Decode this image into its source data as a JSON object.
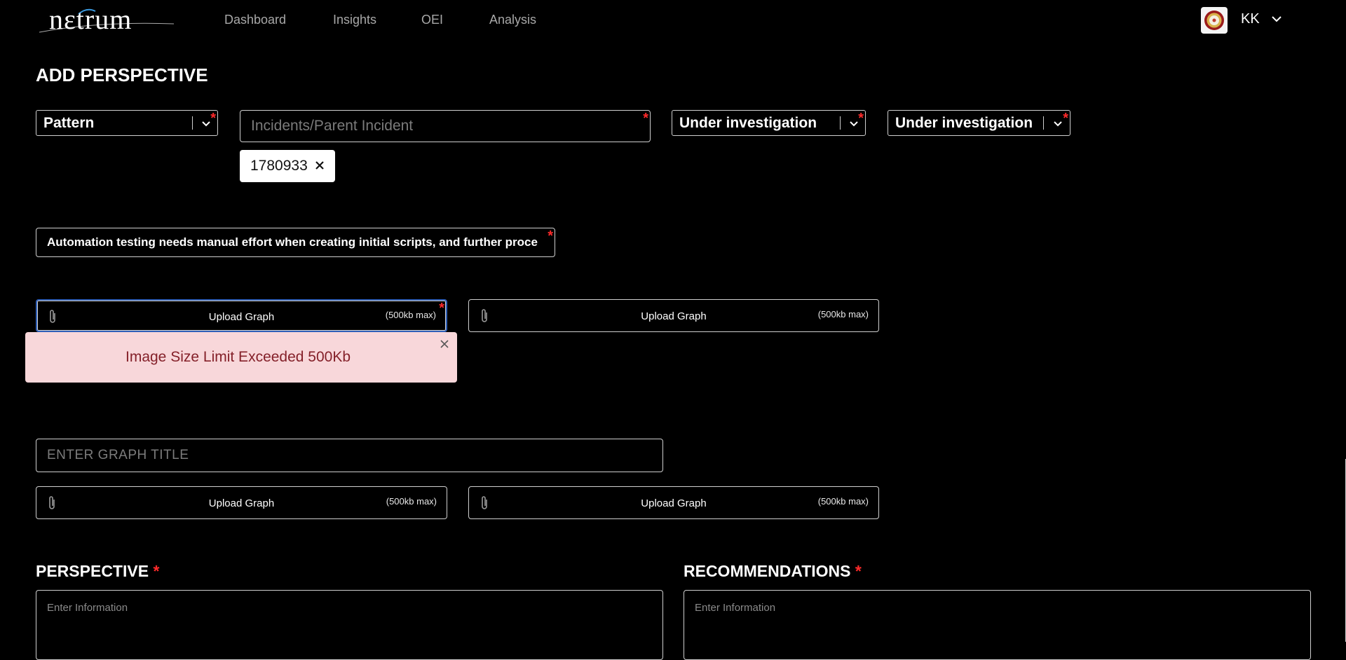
{
  "nav": {
    "logo_text": "nεtrum",
    "links": [
      "Dashboard",
      "Insights",
      "OEI",
      "Analysis"
    ],
    "user_initials": "KK"
  },
  "page": {
    "title": "ADD PERSPECTIVE"
  },
  "form": {
    "type_select": "Pattern",
    "incident_placeholder": "Incidents/Parent Incident",
    "incident_chip": "1780933",
    "status_select_1": "Under investigation",
    "status_select_2": "Under investigation",
    "summary": "Automation testing needs manual effort when creating initial scripts, and further proce",
    "required_mark": "*",
    "upload_label": "Upload Graph",
    "upload_max": "(500kb max)",
    "graph_title_placeholder": "ENTER GRAPH TITLE",
    "perspective_heading": "PERSPECTIVE",
    "recommendations_heading": "RECOMMENDATIONS",
    "textarea_placeholder": "Enter Information"
  },
  "alert": {
    "message": "Image Size Limit Exceeded 500Kb"
  },
  "colors": {
    "background": "#000000",
    "required": "#ff2a2a",
    "alert_bg": "#f8d7da",
    "alert_text": "#842029",
    "focus_border": "#2f5fb8"
  },
  "icons": [
    "logo-swoosh",
    "avatar-seal",
    "chevron-down-icon",
    "close-icon",
    "paperclip-icon"
  ]
}
